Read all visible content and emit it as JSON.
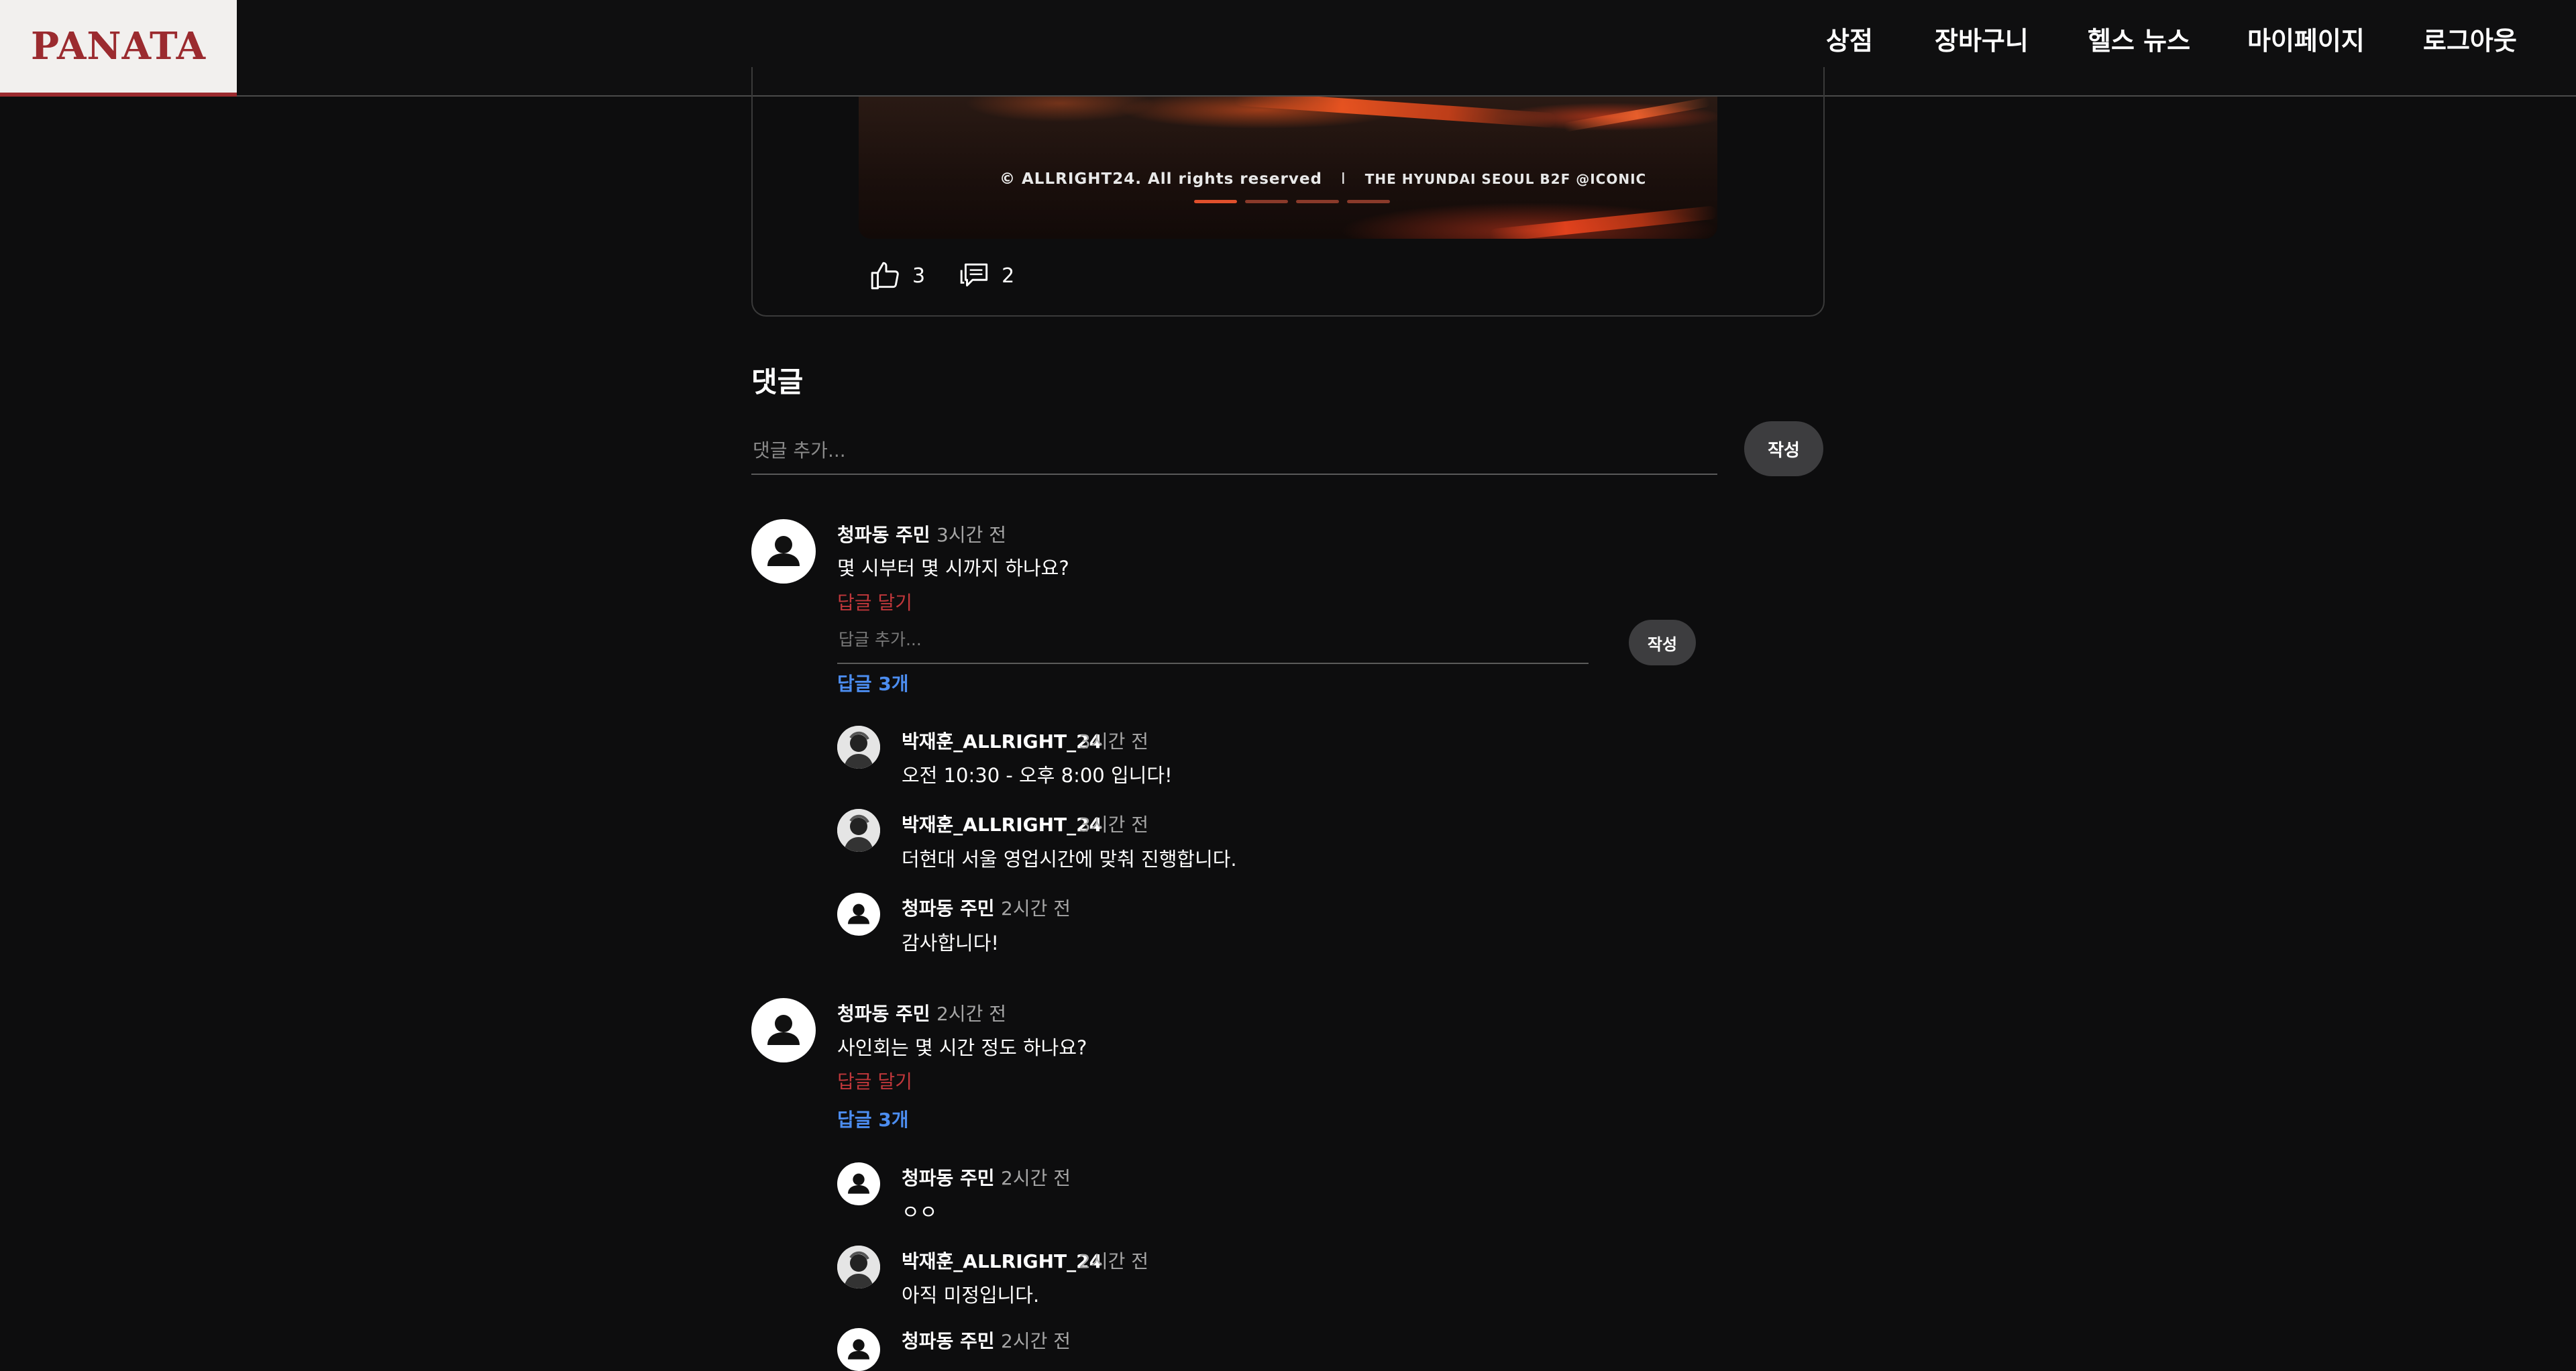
{
  "header": {
    "logo": "PANATA",
    "nav": [
      "상점",
      "장바구니",
      "헬스 뉴스",
      "마이페이지",
      "로그아웃"
    ]
  },
  "post": {
    "image_caption": "© ALLRIGHT24. All rights reserved",
    "image_separator": "I",
    "image_location": "THE HYUNDAI SEOUL B2F @ICONIC",
    "likes": "3",
    "comments": "2"
  },
  "comments_section": {
    "title": "댓글",
    "input_placeholder": "댓글 추가...",
    "submit_label": "작성",
    "reply_input_placeholder": "답글 추가...",
    "reply_submit_label": "작성"
  },
  "comments": [
    {
      "author": "청파동 주민",
      "time": "3시간 전",
      "text": "몇 시부터 몇 시까지 하나요?",
      "reply_action": "답글 달기",
      "replies_toggle": "답글 3개",
      "replies": [
        {
          "author": "박재훈_ALLRIGHT_24",
          "time": "3시간 전",
          "text": "오전 10:30 - 오후 8:00 입니다!"
        },
        {
          "author": "박재훈_ALLRIGHT_24",
          "time": "3시간 전",
          "text": "더현대 서울 영업시간에 맞춰 진행합니다."
        },
        {
          "author": "청파동 주민",
          "time": "2시간 전",
          "text": "감사합니다!"
        }
      ]
    },
    {
      "author": "청파동 주민",
      "time": "2시간 전",
      "text": "사인회는 몇 시간 정도 하나요?",
      "reply_action": "답글 달기",
      "replies_toggle": "답글 3개",
      "replies": [
        {
          "author": "청파동 주민",
          "time": "2시간 전",
          "text": "ㅇㅇ"
        },
        {
          "author": "박재훈_ALLRIGHT_24",
          "time": "2시간 전",
          "text": "아직 미정입니다."
        },
        {
          "author": "청파동 주민",
          "time": "2시간 전",
          "text": ""
        }
      ]
    }
  ],
  "colors": {
    "brand": "#9b2b2f",
    "background": "#0d0d0e",
    "reply_action": "#c0373b",
    "replies_toggle": "#4c8df0"
  },
  "icons": {
    "like": "thumbs-up-icon",
    "comment": "comment-bubble-icon",
    "default_avatar": "user-icon"
  }
}
